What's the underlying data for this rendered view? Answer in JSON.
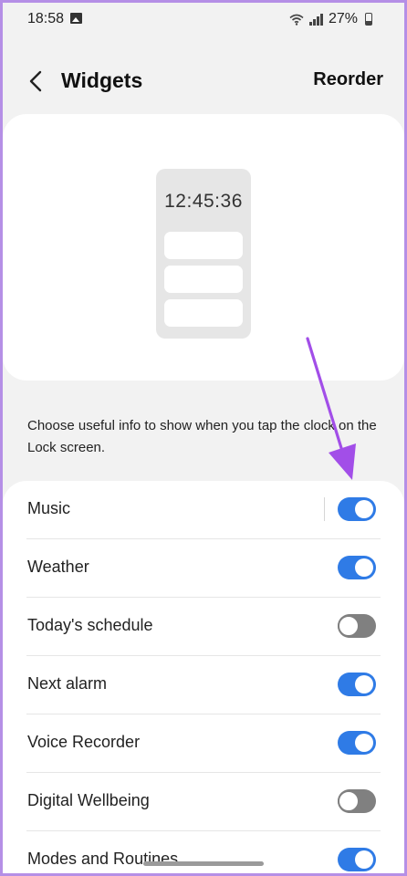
{
  "status_bar": {
    "time": "18:58",
    "battery": "27%"
  },
  "header": {
    "title": "Widgets",
    "reorder_label": "Reorder"
  },
  "preview": {
    "clock": "12:45:36"
  },
  "description": "Choose useful info to show when you tap the clock on the Lock screen.",
  "widgets": [
    {
      "label": "Music",
      "enabled": true
    },
    {
      "label": "Weather",
      "enabled": true
    },
    {
      "label": "Today's schedule",
      "enabled": false
    },
    {
      "label": "Next alarm",
      "enabled": true
    },
    {
      "label": "Voice Recorder",
      "enabled": true
    },
    {
      "label": "Digital Wellbeing",
      "enabled": false
    },
    {
      "label": "Modes and Routines",
      "enabled": true
    }
  ],
  "colors": {
    "toggle_on": "#2f7be6",
    "toggle_off": "#808080",
    "arrow": "#a24ee8",
    "frame": "#b58fe6"
  }
}
